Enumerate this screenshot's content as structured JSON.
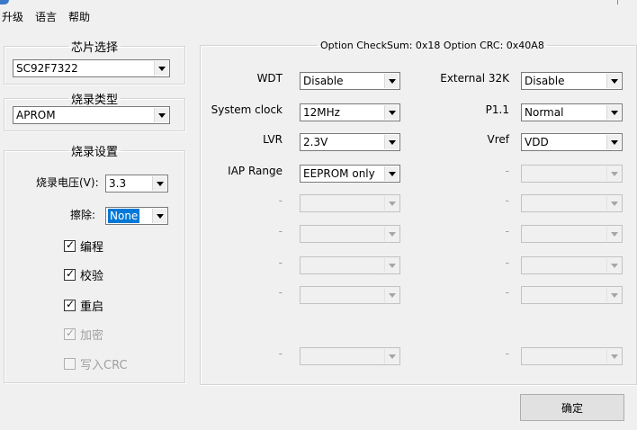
{
  "menu": [
    "升级",
    "语言",
    "帮助"
  ],
  "chip_select": {
    "legend": "芯片选择",
    "value": "SC92F7322"
  },
  "burn_type": {
    "legend": "烧录类型",
    "value": "APROM"
  },
  "burn_settings": {
    "legend": "烧录设置",
    "voltage_label": "烧录电压(V):",
    "voltage_value": "3.3",
    "erase_label": "擦除:",
    "erase_value": "None",
    "checks": [
      {
        "label": "编程",
        "checked": true,
        "enabled": true
      },
      {
        "label": "校验",
        "checked": true,
        "enabled": true
      },
      {
        "label": "重启",
        "checked": true,
        "enabled": true
      },
      {
        "label": "加密",
        "checked": true,
        "enabled": false
      },
      {
        "label": "写入CRC",
        "checked": false,
        "enabled": false
      }
    ]
  },
  "options": {
    "legend": "Option CheckSum:  0x18  Option CRC:  0x40A8",
    "left": [
      {
        "label": "WDT",
        "value": "Disable",
        "enabled": true
      },
      {
        "label": "System clock",
        "value": "12MHz",
        "enabled": true
      },
      {
        "label": "LVR",
        "value": "2.3V",
        "enabled": true
      },
      {
        "label": "IAP Range",
        "value": "EEPROM only",
        "enabled": true
      },
      {
        "label": "-",
        "value": "",
        "enabled": false
      },
      {
        "label": "-",
        "value": "",
        "enabled": false
      },
      {
        "label": "-",
        "value": "",
        "enabled": false
      },
      {
        "label": "-",
        "value": "",
        "enabled": false
      },
      {
        "label": "-",
        "value": "",
        "enabled": false
      }
    ],
    "right": [
      {
        "label": "External 32K",
        "value": "Disable",
        "enabled": true
      },
      {
        "label": "P1.1",
        "value": "Normal",
        "enabled": true
      },
      {
        "label": "Vref",
        "value": "VDD",
        "enabled": true
      },
      {
        "label": "-",
        "value": "",
        "enabled": false
      },
      {
        "label": "-",
        "value": "",
        "enabled": false
      },
      {
        "label": "-",
        "value": "",
        "enabled": false
      },
      {
        "label": "-",
        "value": "",
        "enabled": false
      },
      {
        "label": "-",
        "value": "",
        "enabled": false
      },
      {
        "label": "-",
        "value": "",
        "enabled": false
      }
    ]
  },
  "ok_button": "确定"
}
